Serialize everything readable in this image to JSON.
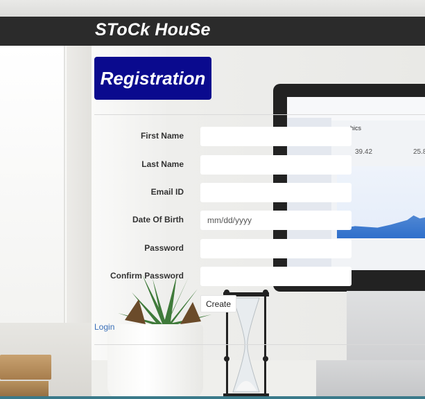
{
  "header": {
    "brand": "SToCk HouSe"
  },
  "page": {
    "title": "Registration"
  },
  "form": {
    "fields": [
      {
        "label": "First Name",
        "value": "",
        "placeholder": ""
      },
      {
        "label": "Last Name",
        "value": "",
        "placeholder": ""
      },
      {
        "label": "Email ID",
        "value": "",
        "placeholder": ""
      },
      {
        "label": "Date Of Birth",
        "value": "",
        "placeholder": "mm/dd/yyyy"
      },
      {
        "label": "Password",
        "value": "",
        "placeholder": ""
      },
      {
        "label": "Confirm Password",
        "value": "",
        "placeholder": ""
      }
    ],
    "submit_label": "Create"
  },
  "links": {
    "login": "Login"
  },
  "background": {
    "screen_title": "phics",
    "screen_value_1": "39.42",
    "screen_value_2": "25.8"
  },
  "colors": {
    "header_bg": "#2b2b2b",
    "badge_bg": "#0a0a8e",
    "link": "#3a6fb8"
  }
}
